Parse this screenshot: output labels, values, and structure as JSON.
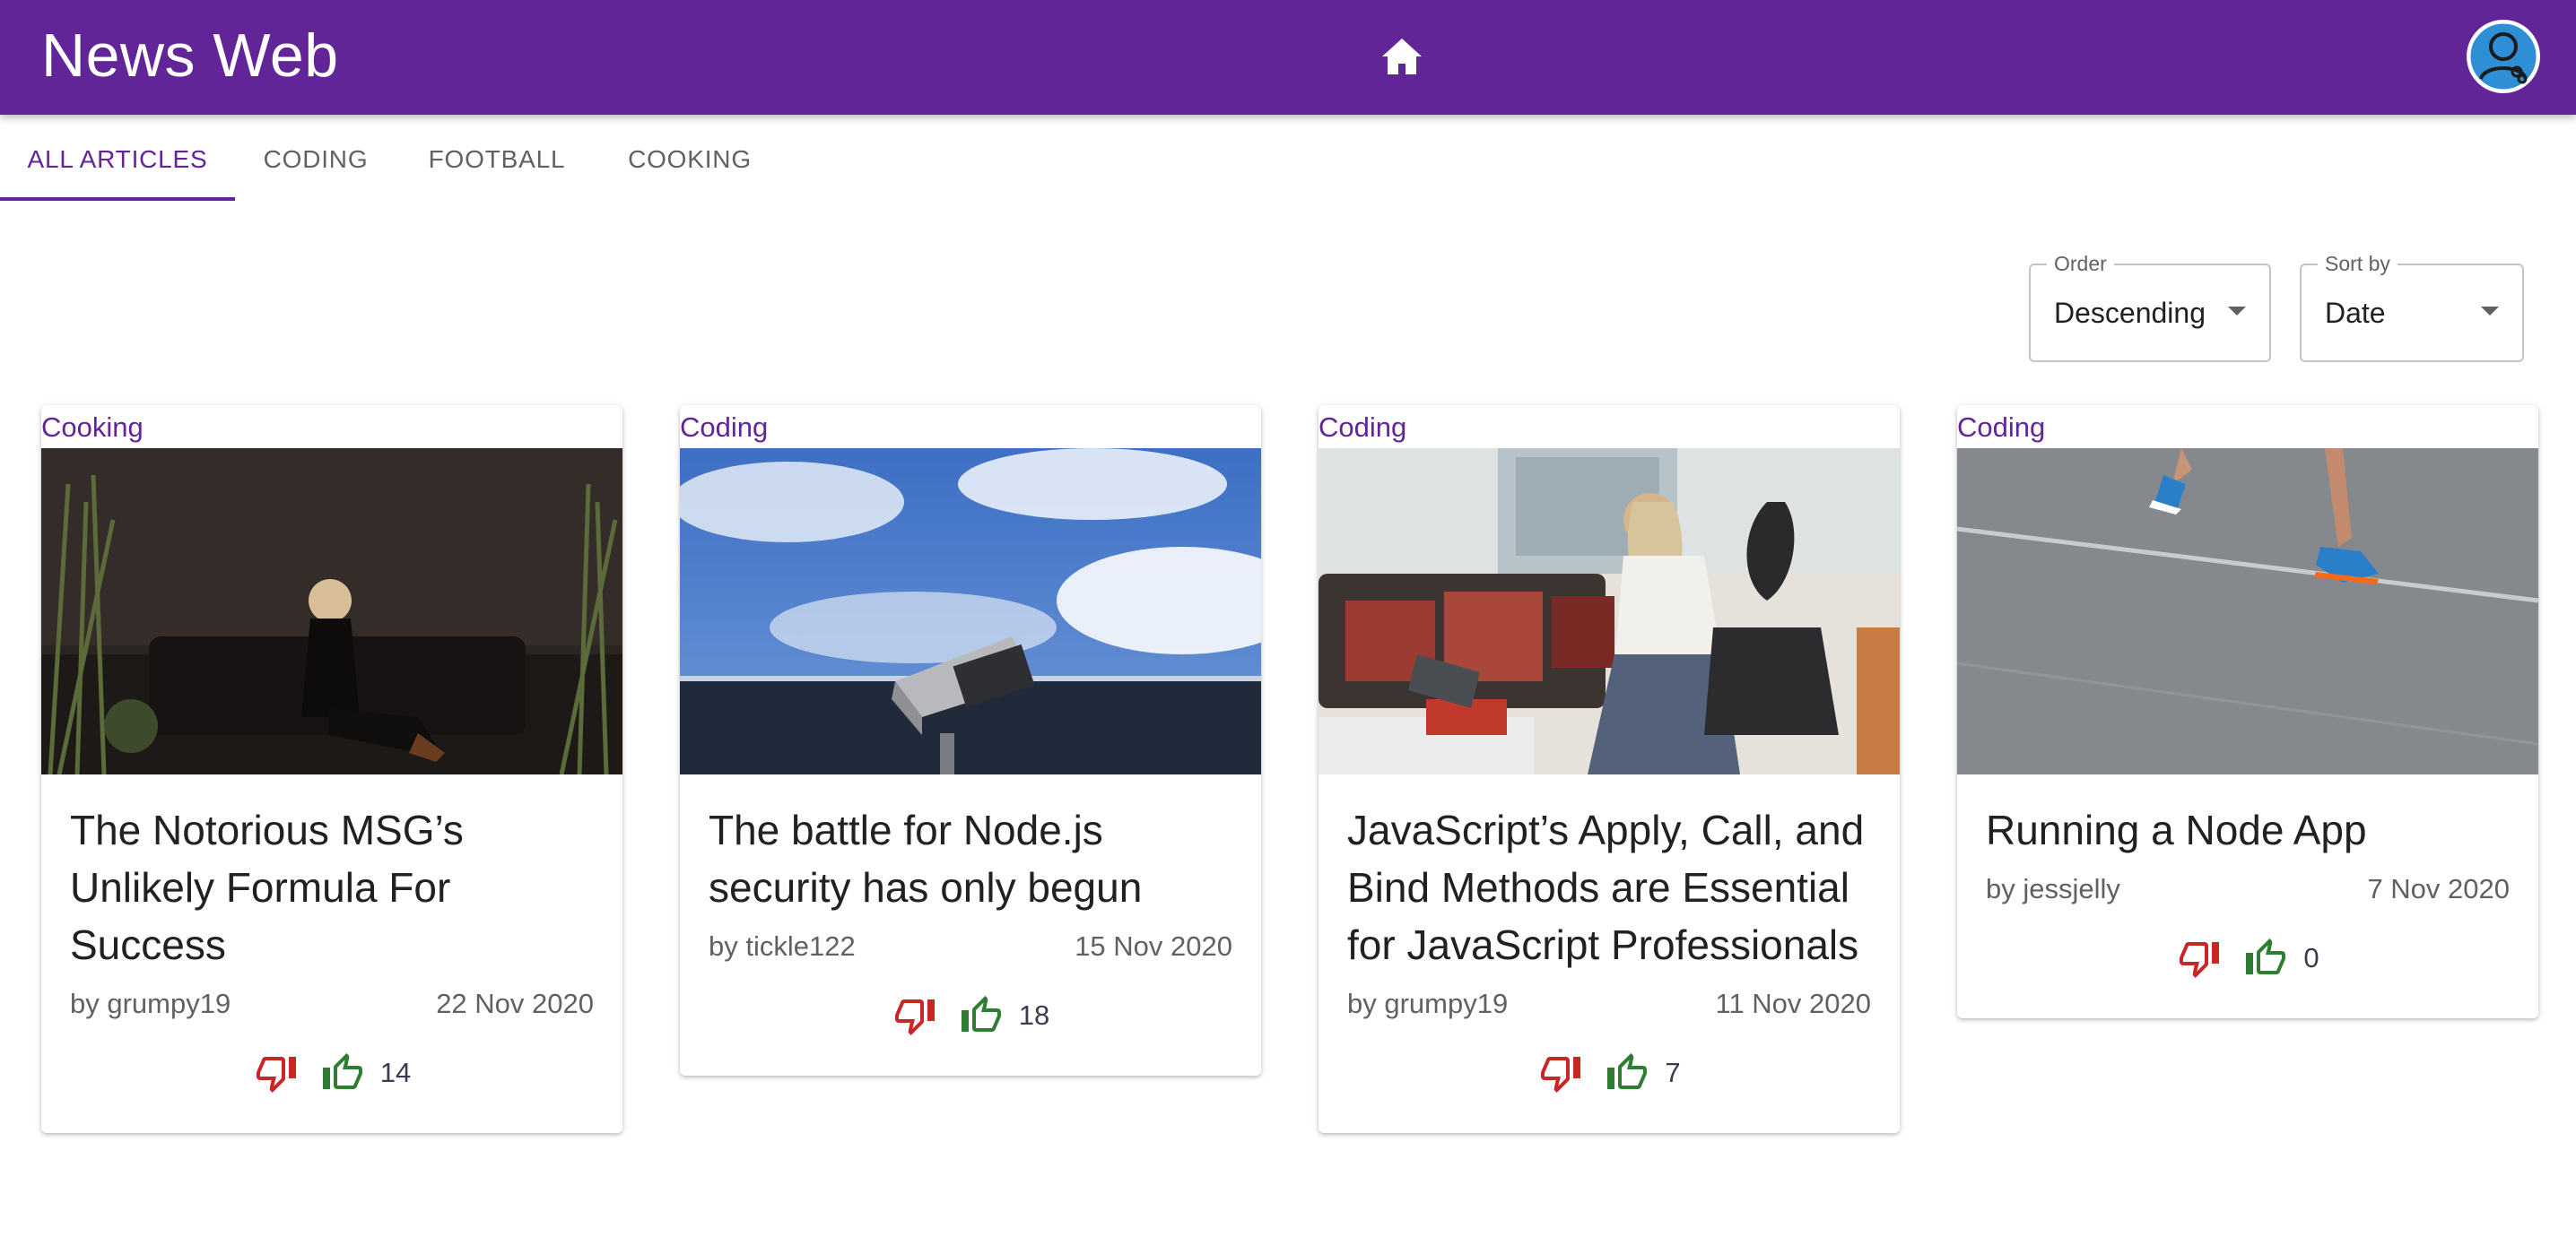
{
  "app": {
    "title": "News Web"
  },
  "icons": {
    "home": "home-icon",
    "avatar": "user-avatar",
    "vote_down": "thumb-down-icon",
    "vote_up": "thumb-up-icon"
  },
  "colors": {
    "primary": "#622597",
    "down": "#c62828",
    "up": "#2e7d32"
  },
  "tabs": [
    {
      "label": "ALL ARTICLES",
      "active": true
    },
    {
      "label": "CODING",
      "active": false
    },
    {
      "label": "FOOTBALL",
      "active": false
    },
    {
      "label": "COOKING",
      "active": false
    }
  ],
  "order": {
    "label": "Order",
    "value": "Descending"
  },
  "sort": {
    "label": "Sort by",
    "value": "Date"
  },
  "articles": [
    {
      "topic": "Cooking",
      "title": "The Notorious MSG’s Unlikely Formula For Success",
      "author": "by grumpy19",
      "date": "22 Nov 2020",
      "votes": "14"
    },
    {
      "topic": "Coding",
      "title": "The battle for Node.js security has only begun",
      "author": "by tickle122",
      "date": "15 Nov 2020",
      "votes": "18"
    },
    {
      "topic": "Coding",
      "title": "JavaScript’s Apply, Call, and Bind Methods are Essential for JavaScript Professionals",
      "author": "by grumpy19",
      "date": "11 Nov 2020",
      "votes": "7"
    },
    {
      "topic": "Coding",
      "title": "Running a Node App",
      "author": "by jessjelly",
      "date": "7 Nov 2020",
      "votes": "0"
    }
  ]
}
